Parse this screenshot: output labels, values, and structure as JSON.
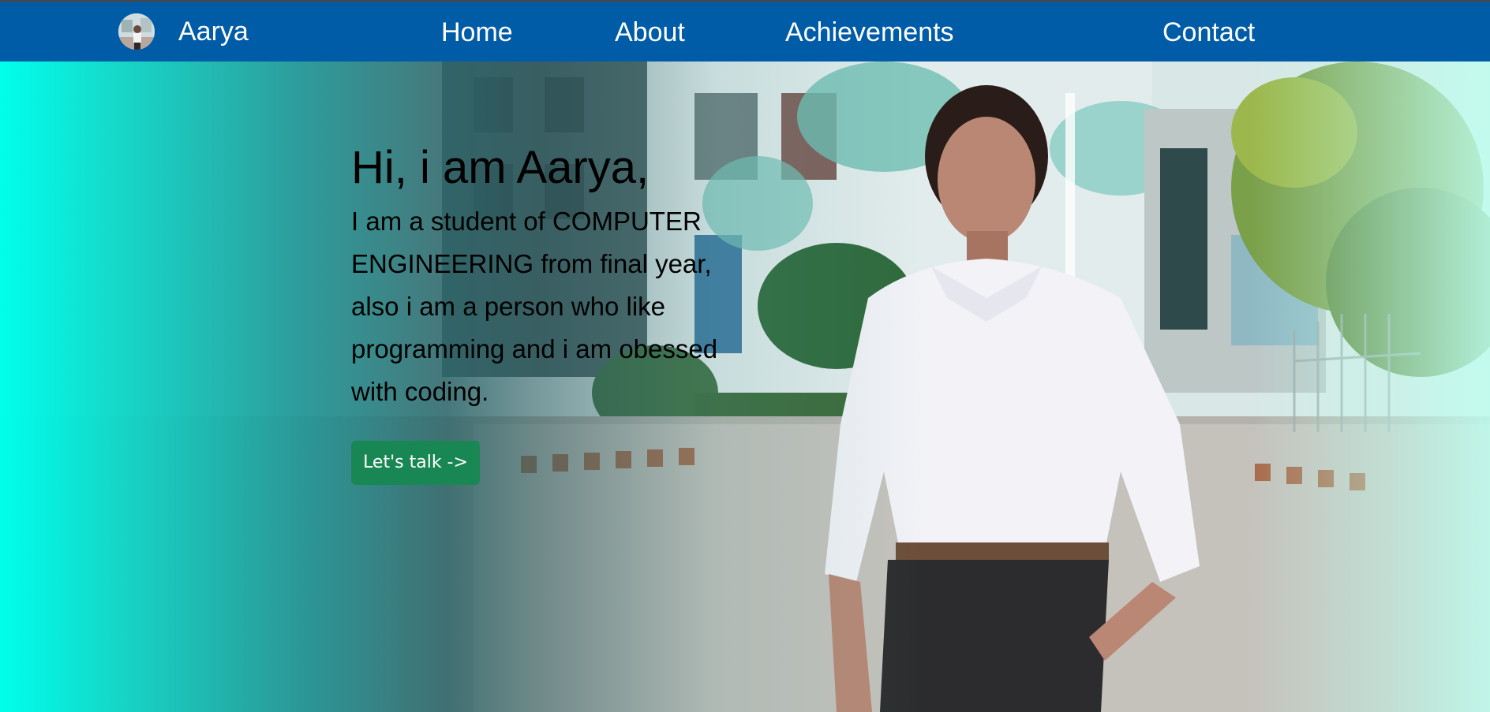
{
  "navbar": {
    "brand_name": "Aarya",
    "links": [
      {
        "label": "Home"
      },
      {
        "label": "About"
      },
      {
        "label": "Achievements"
      },
      {
        "label": "Contact"
      }
    ],
    "background_color": "#015ca7"
  },
  "hero": {
    "title": "Hi, i am Aarya,",
    "description": "I am a student of COMPUTER ENGINEERING from final year, also i am a person who like programming and i am obessed with coding.",
    "cta_label": "Let's talk ->",
    "cta_color": "#198754",
    "overlay_color": "#00ffeb"
  }
}
